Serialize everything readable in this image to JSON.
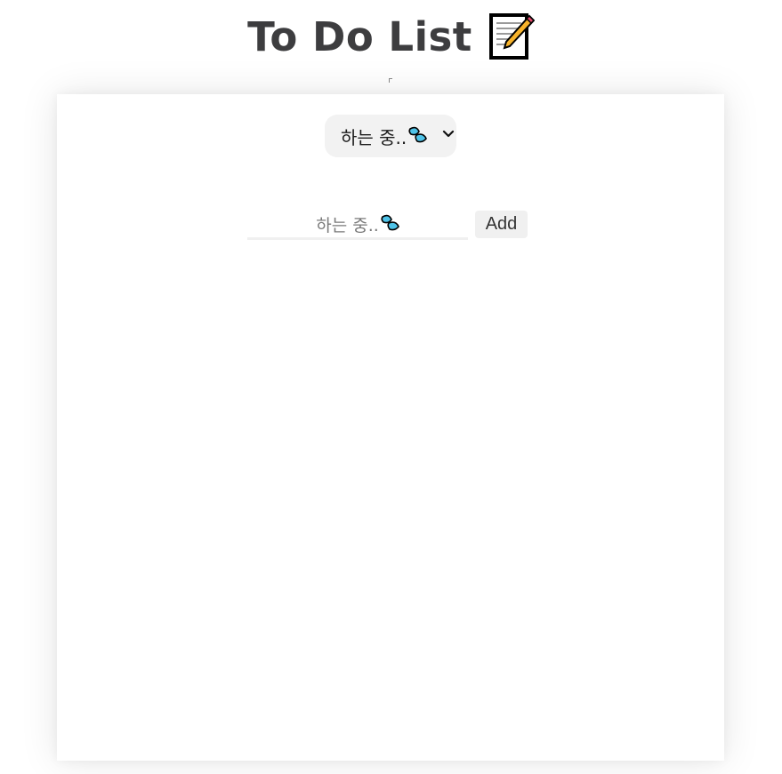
{
  "header": {
    "title": "To Do List",
    "title_icon": "memo-icon"
  },
  "filter": {
    "selected_label": "하는 중..",
    "selected_icon": "sweat-droplets-icon",
    "dropdown_icon": "chevron-down-icon"
  },
  "form": {
    "input_value": "",
    "input_placeholder": "하는 중..",
    "placeholder_icon": "sweat-droplets-icon",
    "add_label": "Add"
  },
  "todos": [],
  "colors": {
    "title": "#3d3d3f",
    "select_bg": "#f2f2f2",
    "button_bg": "#f0f0f0",
    "drop_fill": "#4fc3e8"
  }
}
